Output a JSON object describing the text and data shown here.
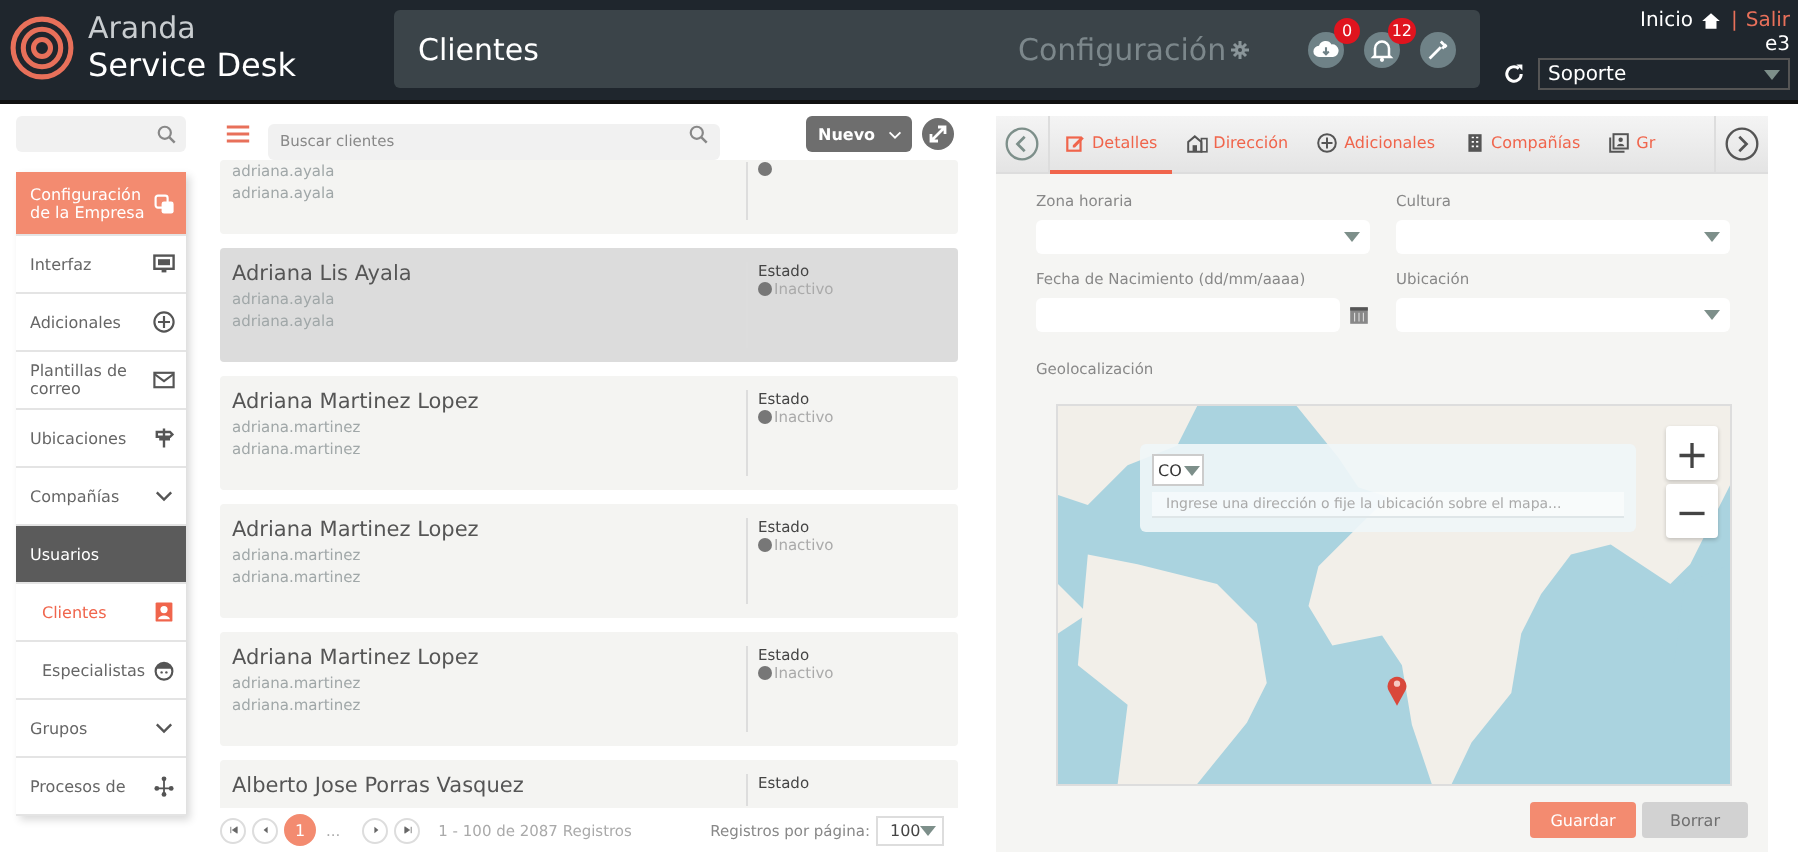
{
  "header": {
    "brand_top": "Aranda",
    "brand_bottom": "Service Desk",
    "title": "Clientes",
    "section": "Configuración",
    "badges": [
      {
        "kind": "cloud",
        "count": "0"
      },
      {
        "kind": "bell",
        "count": "12"
      },
      {
        "kind": "tools"
      }
    ],
    "home_link": "Inicio",
    "separator": "|",
    "logout_link": "Salir",
    "user": "e3",
    "project": "Soporte"
  },
  "sidebar": {
    "items": [
      {
        "label": "Configuración de la Empresa",
        "kind": "section",
        "selected": false
      },
      {
        "label": "Interfaz",
        "kind": "item",
        "selected": false
      },
      {
        "label": "Adicionales",
        "kind": "item",
        "selected": false
      },
      {
        "label": "Plantillas de correo",
        "kind": "item",
        "selected": false
      },
      {
        "label": "Ubicaciones",
        "kind": "item",
        "selected": false
      },
      {
        "label": "Compañías",
        "kind": "item",
        "selected": false
      },
      {
        "label": "Usuarios",
        "kind": "group",
        "selected": false
      },
      {
        "label": "Clientes",
        "kind": "sub",
        "selected": true
      },
      {
        "label": "Especialistas",
        "kind": "sub",
        "selected": false
      },
      {
        "label": "Grupos",
        "kind": "item",
        "selected": false
      },
      {
        "label": "Procesos de",
        "kind": "item",
        "selected": false
      }
    ]
  },
  "list": {
    "search_placeholder": "Buscar clientes",
    "new_button": "Nuevo",
    "cards": [
      {
        "kind": "partial",
        "logins": [
          "adriana.ayala",
          "adriana.ayala"
        ],
        "selected": false
      },
      {
        "kind": "full",
        "name": "Adriana Lis Ayala",
        "logins": [
          "adriana.ayala",
          "adriana.ayala"
        ],
        "status_label": "Estado",
        "status": "Inactivo",
        "selected": true
      },
      {
        "kind": "full",
        "name": "Adriana Martinez Lopez",
        "logins": [
          "adriana.martinez",
          "adriana.martinez"
        ],
        "status_label": "Estado",
        "status": "Inactivo",
        "selected": false
      },
      {
        "kind": "full",
        "name": "Adriana Martinez Lopez",
        "logins": [
          "adriana.martinez",
          "adriana.martinez"
        ],
        "status_label": "Estado",
        "status": "Inactivo",
        "selected": false
      },
      {
        "kind": "full",
        "name": "Adriana Martinez Lopez",
        "logins": [
          "adriana.martinez",
          "adriana.martinez"
        ],
        "status_label": "Estado",
        "status": "Inactivo",
        "selected": false
      },
      {
        "kind": "cut",
        "name": "Alberto Jose Porras Vasquez",
        "status_label": "Estado",
        "selected": false
      }
    ],
    "pagination": {
      "pages": [
        {
          "label": "1",
          "selected": true
        }
      ],
      "ellipsis": "...",
      "summary": "1 - 100 de 2087 Registros",
      "per_page_label": "Registros por página:",
      "per_page": "100"
    }
  },
  "detail": {
    "tabs": [
      {
        "label": "Detalles",
        "selected": true
      },
      {
        "label": "Dirección",
        "selected": false
      },
      {
        "label": "Adicionales",
        "selected": false
      },
      {
        "label": "Compañías",
        "selected": false
      },
      {
        "label": "Gr",
        "selected": false
      }
    ],
    "fields": [
      {
        "label": "Zona horaria",
        "kind": "select"
      },
      {
        "label": "Cultura",
        "kind": "select"
      },
      {
        "label": "Fecha de Nacimiento (dd/mm/aaaa)",
        "kind": "date"
      },
      {
        "label": "Ubicación",
        "kind": "select"
      }
    ],
    "geo_label": "Geolocalización",
    "map": {
      "country": "CO",
      "address_placeholder": "Ingrese una dirección o fije la ubicación sobre el mapa...",
      "zoom_in": "+",
      "zoom_out": "−"
    },
    "buttons": [
      {
        "label": "Guardar",
        "kind": "primary",
        "disabled": false
      },
      {
        "label": "Borrar",
        "kind": "secondary",
        "disabled": true
      }
    ]
  }
}
